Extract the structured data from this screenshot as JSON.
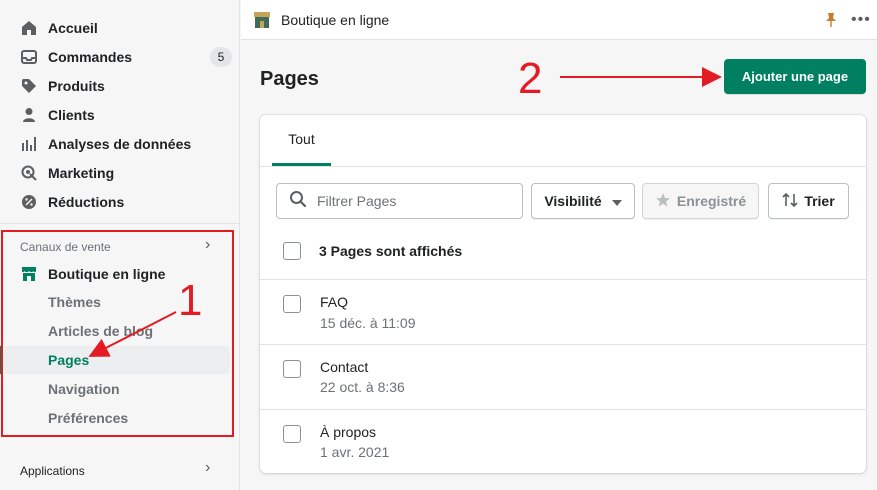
{
  "sidebar": {
    "items": [
      {
        "label": "Accueil",
        "icon": "home-icon"
      },
      {
        "label": "Commandes",
        "icon": "orders-icon",
        "badge": "5"
      },
      {
        "label": "Produits",
        "icon": "tag-icon"
      },
      {
        "label": "Clients",
        "icon": "person-icon"
      },
      {
        "label": "Analyses de données",
        "icon": "bar-chart-icon"
      },
      {
        "label": "Marketing",
        "icon": "target-icon"
      },
      {
        "label": "Réductions",
        "icon": "discount-icon"
      }
    ],
    "sales_channels_label": "Canaux de vente",
    "store_label": "Boutique en ligne",
    "sub_items": [
      "Thèmes",
      "Articles de blog",
      "Pages",
      "Navigation",
      "Préférences"
    ],
    "apps_label": "Applications"
  },
  "topbar": {
    "store_name": "Boutique en ligne"
  },
  "main": {
    "title": "Pages",
    "add_button": "Ajouter une page",
    "tab_all": "Tout",
    "search_placeholder": "Filtrer Pages",
    "visibility_button": "Visibilité",
    "saved_button": "Enregistré",
    "sort_button": "Trier",
    "count_label": "3 Pages sont affichés",
    "rows": [
      {
        "title": "FAQ",
        "date": "15 déc. à 11:09"
      },
      {
        "title": "Contact",
        "date": "22 oct. à 8:36"
      },
      {
        "title": "À propos",
        "date": "1 avr. 2021"
      }
    ]
  },
  "annotations": {
    "one": "1",
    "two": "2"
  },
  "colors": {
    "brand": "#008060",
    "annotation": "#e31b23"
  }
}
